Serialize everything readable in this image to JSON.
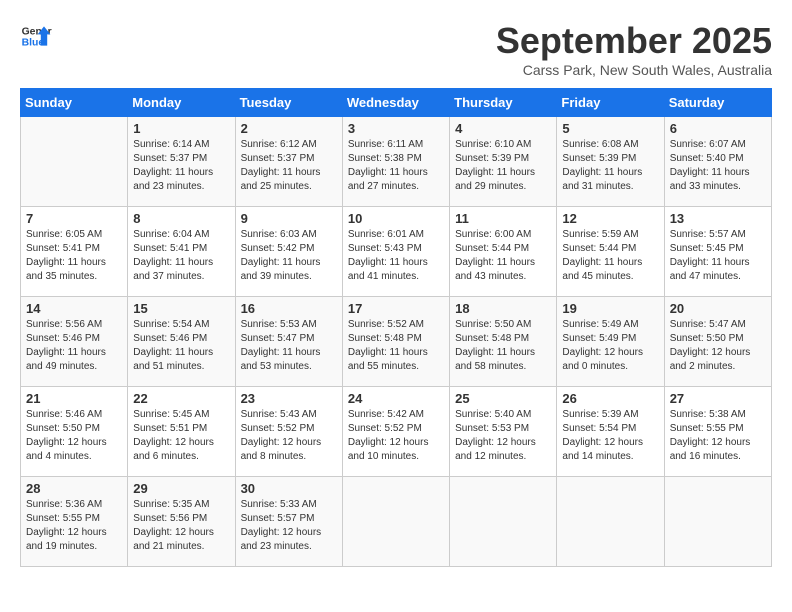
{
  "app": {
    "name": "GeneralBlue",
    "logo_line1": "General",
    "logo_line2": "Blue"
  },
  "calendar": {
    "month": "September 2025",
    "location": "Carss Park, New South Wales, Australia",
    "headers": [
      "Sunday",
      "Monday",
      "Tuesday",
      "Wednesday",
      "Thursday",
      "Friday",
      "Saturday"
    ],
    "weeks": [
      [
        {
          "day": "",
          "sunrise": "",
          "sunset": "",
          "daylight": ""
        },
        {
          "day": "1",
          "sunrise": "Sunrise: 6:14 AM",
          "sunset": "Sunset: 5:37 PM",
          "daylight": "Daylight: 11 hours and 23 minutes."
        },
        {
          "day": "2",
          "sunrise": "Sunrise: 6:12 AM",
          "sunset": "Sunset: 5:37 PM",
          "daylight": "Daylight: 11 hours and 25 minutes."
        },
        {
          "day": "3",
          "sunrise": "Sunrise: 6:11 AM",
          "sunset": "Sunset: 5:38 PM",
          "daylight": "Daylight: 11 hours and 27 minutes."
        },
        {
          "day": "4",
          "sunrise": "Sunrise: 6:10 AM",
          "sunset": "Sunset: 5:39 PM",
          "daylight": "Daylight: 11 hours and 29 minutes."
        },
        {
          "day": "5",
          "sunrise": "Sunrise: 6:08 AM",
          "sunset": "Sunset: 5:39 PM",
          "daylight": "Daylight: 11 hours and 31 minutes."
        },
        {
          "day": "6",
          "sunrise": "Sunrise: 6:07 AM",
          "sunset": "Sunset: 5:40 PM",
          "daylight": "Daylight: 11 hours and 33 minutes."
        }
      ],
      [
        {
          "day": "7",
          "sunrise": "Sunrise: 6:05 AM",
          "sunset": "Sunset: 5:41 PM",
          "daylight": "Daylight: 11 hours and 35 minutes."
        },
        {
          "day": "8",
          "sunrise": "Sunrise: 6:04 AM",
          "sunset": "Sunset: 5:41 PM",
          "daylight": "Daylight: 11 hours and 37 minutes."
        },
        {
          "day": "9",
          "sunrise": "Sunrise: 6:03 AM",
          "sunset": "Sunset: 5:42 PM",
          "daylight": "Daylight: 11 hours and 39 minutes."
        },
        {
          "day": "10",
          "sunrise": "Sunrise: 6:01 AM",
          "sunset": "Sunset: 5:43 PM",
          "daylight": "Daylight: 11 hours and 41 minutes."
        },
        {
          "day": "11",
          "sunrise": "Sunrise: 6:00 AM",
          "sunset": "Sunset: 5:44 PM",
          "daylight": "Daylight: 11 hours and 43 minutes."
        },
        {
          "day": "12",
          "sunrise": "Sunrise: 5:59 AM",
          "sunset": "Sunset: 5:44 PM",
          "daylight": "Daylight: 11 hours and 45 minutes."
        },
        {
          "day": "13",
          "sunrise": "Sunrise: 5:57 AM",
          "sunset": "Sunset: 5:45 PM",
          "daylight": "Daylight: 11 hours and 47 minutes."
        }
      ],
      [
        {
          "day": "14",
          "sunrise": "Sunrise: 5:56 AM",
          "sunset": "Sunset: 5:46 PM",
          "daylight": "Daylight: 11 hours and 49 minutes."
        },
        {
          "day": "15",
          "sunrise": "Sunrise: 5:54 AM",
          "sunset": "Sunset: 5:46 PM",
          "daylight": "Daylight: 11 hours and 51 minutes."
        },
        {
          "day": "16",
          "sunrise": "Sunrise: 5:53 AM",
          "sunset": "Sunset: 5:47 PM",
          "daylight": "Daylight: 11 hours and 53 minutes."
        },
        {
          "day": "17",
          "sunrise": "Sunrise: 5:52 AM",
          "sunset": "Sunset: 5:48 PM",
          "daylight": "Daylight: 11 hours and 55 minutes."
        },
        {
          "day": "18",
          "sunrise": "Sunrise: 5:50 AM",
          "sunset": "Sunset: 5:48 PM",
          "daylight": "Daylight: 11 hours and 58 minutes."
        },
        {
          "day": "19",
          "sunrise": "Sunrise: 5:49 AM",
          "sunset": "Sunset: 5:49 PM",
          "daylight": "Daylight: 12 hours and 0 minutes."
        },
        {
          "day": "20",
          "sunrise": "Sunrise: 5:47 AM",
          "sunset": "Sunset: 5:50 PM",
          "daylight": "Daylight: 12 hours and 2 minutes."
        }
      ],
      [
        {
          "day": "21",
          "sunrise": "Sunrise: 5:46 AM",
          "sunset": "Sunset: 5:50 PM",
          "daylight": "Daylight: 12 hours and 4 minutes."
        },
        {
          "day": "22",
          "sunrise": "Sunrise: 5:45 AM",
          "sunset": "Sunset: 5:51 PM",
          "daylight": "Daylight: 12 hours and 6 minutes."
        },
        {
          "day": "23",
          "sunrise": "Sunrise: 5:43 AM",
          "sunset": "Sunset: 5:52 PM",
          "daylight": "Daylight: 12 hours and 8 minutes."
        },
        {
          "day": "24",
          "sunrise": "Sunrise: 5:42 AM",
          "sunset": "Sunset: 5:52 PM",
          "daylight": "Daylight: 12 hours and 10 minutes."
        },
        {
          "day": "25",
          "sunrise": "Sunrise: 5:40 AM",
          "sunset": "Sunset: 5:53 PM",
          "daylight": "Daylight: 12 hours and 12 minutes."
        },
        {
          "day": "26",
          "sunrise": "Sunrise: 5:39 AM",
          "sunset": "Sunset: 5:54 PM",
          "daylight": "Daylight: 12 hours and 14 minutes."
        },
        {
          "day": "27",
          "sunrise": "Sunrise: 5:38 AM",
          "sunset": "Sunset: 5:55 PM",
          "daylight": "Daylight: 12 hours and 16 minutes."
        }
      ],
      [
        {
          "day": "28",
          "sunrise": "Sunrise: 5:36 AM",
          "sunset": "Sunset: 5:55 PM",
          "daylight": "Daylight: 12 hours and 19 minutes."
        },
        {
          "day": "29",
          "sunrise": "Sunrise: 5:35 AM",
          "sunset": "Sunset: 5:56 PM",
          "daylight": "Daylight: 12 hours and 21 minutes."
        },
        {
          "day": "30",
          "sunrise": "Sunrise: 5:33 AM",
          "sunset": "Sunset: 5:57 PM",
          "daylight": "Daylight: 12 hours and 23 minutes."
        },
        {
          "day": "",
          "sunrise": "",
          "sunset": "",
          "daylight": ""
        },
        {
          "day": "",
          "sunrise": "",
          "sunset": "",
          "daylight": ""
        },
        {
          "day": "",
          "sunrise": "",
          "sunset": "",
          "daylight": ""
        },
        {
          "day": "",
          "sunrise": "",
          "sunset": "",
          "daylight": ""
        }
      ]
    ]
  }
}
